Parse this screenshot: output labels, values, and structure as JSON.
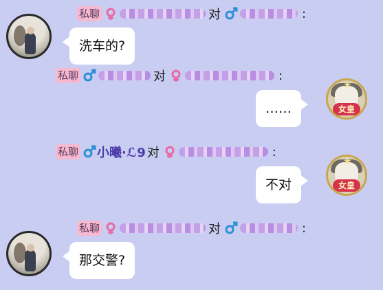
{
  "messages": [
    {
      "tag": "私聊",
      "to": "对",
      "colon": ":",
      "bubble": "洗车的?"
    },
    {
      "tag": "私聊",
      "to": "对",
      "colon": ":",
      "bubble": "……"
    },
    {
      "tag": "私聊",
      "sender_name": "小曦·ℒ9",
      "to": "对",
      "colon": ":",
      "bubble": "不对"
    },
    {
      "tag": "私聊",
      "to": "对",
      "colon": ":",
      "bubble": "那交警?"
    }
  ],
  "avatar_badge": "女皇",
  "icons": {
    "female": "female-icon",
    "male": "male-icon"
  },
  "colors": {
    "background": "#c9cdf2",
    "tag": "#f6b9d0",
    "male": "#2f8fd6",
    "female": "#e86aa8"
  }
}
